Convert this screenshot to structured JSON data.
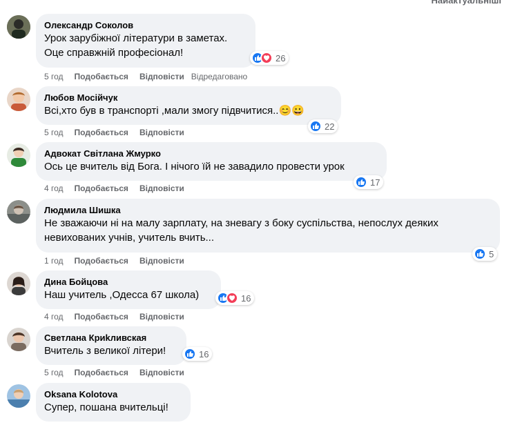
{
  "header_fragment": "Найактуальніші",
  "colors": {
    "bubble": "#f0f2f5",
    "like": "#1877f2",
    "love": "#f33e58",
    "meta": "#65676b"
  },
  "comments": [
    {
      "author": "Олександр Соколов",
      "lines": [
        "Урок зарубіжної літератури в заметах.",
        "Оце справжній професіонал!"
      ],
      "reactions": [
        "like",
        "love"
      ],
      "reaction_count": "26",
      "time": "5 год",
      "like_label": "Подобається",
      "reply_label": "Відповісти",
      "edited_label": "Відредаговано"
    },
    {
      "author": "Любов Мосійчук",
      "lines": [
        "Всі,хто був в транспорті ,мали змогу підвчитися..😊😀"
      ],
      "reactions": [
        "like"
      ],
      "reaction_count": "22",
      "time": "5 год",
      "like_label": "Подобається",
      "reply_label": "Відповісти"
    },
    {
      "author": "Адвокат Світлана Жмурко",
      "lines": [
        "Ось це вчитель від Бога. І нічого їй не завадило провести урок"
      ],
      "reactions": [
        "like"
      ],
      "reaction_count": "17",
      "time": "4 год",
      "like_label": "Подобається",
      "reply_label": "Відповісти"
    },
    {
      "author": "Людмила Шишка",
      "lines": [
        "Не зважаючи ні на малу зарплату, на зневагу з боку суспільства, непослух деяких",
        "невихованих учнів, учитель вчить..."
      ],
      "reactions": [
        "like"
      ],
      "reaction_count": "5",
      "time": "1 год",
      "like_label": "Подобається",
      "reply_label": "Відповісти"
    },
    {
      "author": "Дина Бойцова",
      "lines": [
        "Наш учитель ,Одесса 67 школа)"
      ],
      "reactions": [
        "like",
        "love"
      ],
      "reaction_count": "16",
      "time": "4 год",
      "like_label": "Подобається",
      "reply_label": "Відповісти"
    },
    {
      "author": "Светлана Криkливская",
      "lines": [
        "Вчитель з великої літери!"
      ],
      "reactions": [
        "like"
      ],
      "reaction_count": "16",
      "time": "5 год",
      "like_label": "Подобається",
      "reply_label": "Відповісти"
    },
    {
      "author": "Oksana Kolotova",
      "lines": [
        "Супер, пошана вчительці!"
      ],
      "reactions": [],
      "reaction_count": "",
      "time": "",
      "like_label": "",
      "reply_label": ""
    }
  ]
}
